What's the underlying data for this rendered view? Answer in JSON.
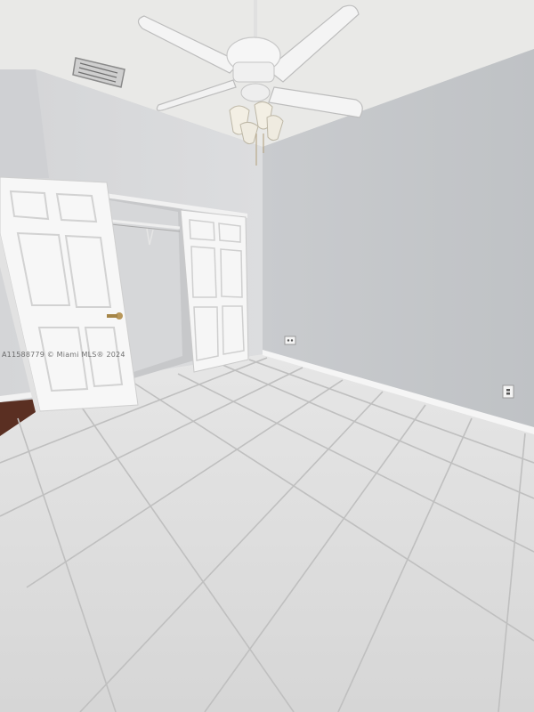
{
  "photo": {
    "subject": "empty-bedroom",
    "watermark": "A11588779 © Miami MLS® 2024",
    "colors": {
      "ceiling": "#e9e9e7",
      "wall_right": "#c4c7ca",
      "wall_left": "#d9dadc",
      "floor_tile": "#dcdcdc",
      "grout": "#bdbdbd",
      "door": "#f6f6f6",
      "fan": "#f3f3f3"
    }
  }
}
